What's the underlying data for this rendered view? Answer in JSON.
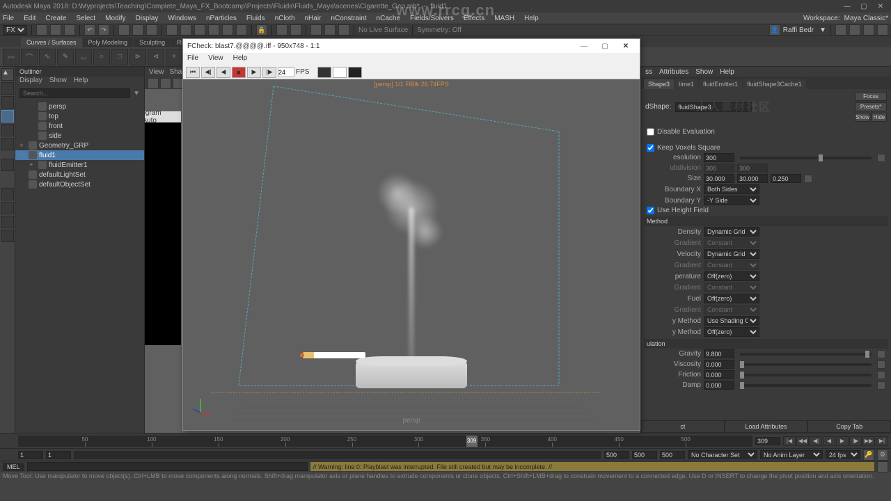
{
  "title": "Autodesk Maya 2018: D:\\Myprojects\\Teaching\\Complete_Maya_FX_Bootcamp\\Projects\\Fluids\\Fluids_Maya\\scenes\\Cigarette_Geo.mb* --- fluid1",
  "url_watermark": "www.rrcg.cn",
  "text_watermark": "人人素材社区",
  "menus": [
    "File",
    "Edit",
    "Create",
    "Select",
    "Modify",
    "Display",
    "Windows",
    "nParticles",
    "Fluids",
    "nCloth",
    "nHair",
    "nConstraint",
    "nCache",
    "Fields/Solvers",
    "Effects",
    "MASH",
    "Help"
  ],
  "workspace_label": "Workspace:",
  "workspace_value": "Maya Classic*",
  "mode_dropdown": "FX",
  "symmetry_label": "Symmetry: Off",
  "nolivesurface": "No Live Surface",
  "user_label": "Raffi Bedr",
  "shelf_tabs": [
    "Curves / Surfaces",
    "Poly Modeling",
    "Sculpting",
    "Rigging"
  ],
  "outliner": {
    "title": "Outliner",
    "menu": [
      "Display",
      "Show",
      "Help"
    ],
    "search_placeholder": "Search...",
    "items": [
      {
        "label": "persp",
        "indent": 1
      },
      {
        "label": "top",
        "indent": 1
      },
      {
        "label": "front",
        "indent": 1
      },
      {
        "label": "side",
        "indent": 1
      },
      {
        "label": "Geometry_GRP",
        "indent": 0,
        "exp": "+"
      },
      {
        "label": "fluid1",
        "indent": 0,
        "exp": "−",
        "sel": true
      },
      {
        "label": "fluidEmitter1",
        "indent": 1,
        "exp": "+"
      },
      {
        "label": "defaultLightSet",
        "indent": 0
      },
      {
        "label": "defaultObjectSet",
        "indent": 0
      }
    ]
  },
  "blackpanel_title": "D:\\Program Files\\Auto",
  "viewport": {
    "tabs": [
      "View",
      "Shad"
    ],
    "persp_label": "persp",
    "overlay_text": "[persp] 1/1 FlBlk 26.74FPS"
  },
  "fcheck": {
    "title": "FCheck: blast7.@@@@.iff - 950x748 - 1:1",
    "menu": [
      "File",
      "View",
      "Help"
    ],
    "fps_value": "24",
    "fps_label": "FPS"
  },
  "attr": {
    "menu": [
      "ss",
      "Attributes",
      "Show",
      "Help"
    ],
    "tabs": [
      "Shape3",
      "time1",
      "fluidEmitter1",
      "fluidShape3Cache1"
    ],
    "shape_label": "dShape:",
    "shape_value": "fluidShape3",
    "btns": [
      "Focus",
      "Presets*",
      "Show",
      "Hide"
    ],
    "disable_eval": "Disable Evaluation",
    "keep_voxels": "Keep Voxels Square",
    "resolution_label": "esolution",
    "resolution": "300",
    "subdiv_label": "ubdivision",
    "subdiv": "300",
    "subdiv2": "300",
    "size_label": "Size",
    "size_x": "30.000",
    "size_y": "30.000",
    "size_z": "0.250",
    "boundx_label": "Boundary X",
    "boundx": "Both Sides",
    "boundy_label": "Boundary Y",
    "boundy": "-Y Side",
    "heightfield": "Use Height Field",
    "method_label": "Method",
    "density_label": "Density",
    "density": "Dynamic Grid",
    "gradient_label": "Gradient",
    "gradient": "Constant",
    "velocity_label": "Velocity",
    "velocity": "Dynamic Grid",
    "temp_label": "perature",
    "temp": "Off(zero)",
    "fuel_label": "Fuel",
    "fuel": "Off(zero)",
    "ymethod_label": "y Method",
    "ymethod1": "Use Shading Color",
    "ymethod2": "Off(zero)",
    "simulation": "ulation",
    "gravity_label": "Gravity",
    "gravity": "9.800",
    "viscosity_label": "Viscosity",
    "viscosity": "0.000",
    "friction_label": "Friction",
    "friction": "0.000",
    "damp_label": "Damp",
    "damp": "0.000",
    "footer": [
      "ct",
      "Load Attributes",
      "Copy Tab"
    ]
  },
  "timeline": {
    "current": "309",
    "end_field": "309",
    "ticks": [
      "50",
      "100",
      "150",
      "200",
      "250",
      "300",
      "350",
      "400",
      "450",
      "500"
    ]
  },
  "range": {
    "start1": "1",
    "start2": "1",
    "end1": "500",
    "end2": "500",
    "end3": "500",
    "charset": "No Character Set",
    "animlayer": "No Anim Layer",
    "fps": "24 fps"
  },
  "cmd": {
    "mel": "MEL",
    "warning": "// Warning: line 0: Playblast was interrupted. File still created but may be incomplete. //"
  },
  "helpline": "Move Tool: Use manipulator to move object(s). Ctrl+LMB to move components along normals. Shift+drag manipulator axis or plane handles to extrude components or clone objects. Ctrl+Shift+LMB+drag to constrain movement to a connected edge. Use D or INSERT to change the pivot position and axis orientation."
}
